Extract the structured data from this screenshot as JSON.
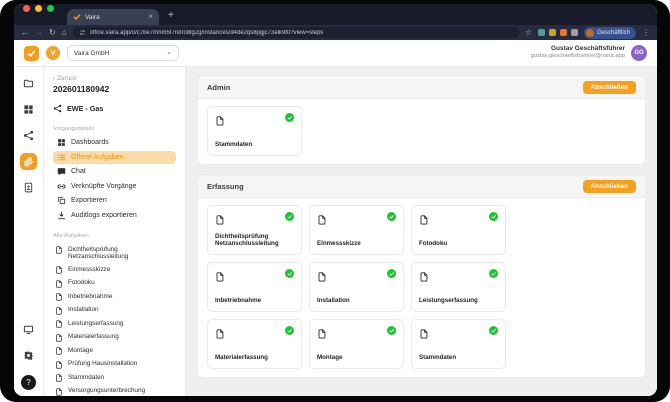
{
  "browser": {
    "tab_title": "Vaira",
    "url": "office.vaira.app/o/c7be7mnm5f7ndro8lg2g/instances/d4de2qs8pgjc73alk9t0?view=steps",
    "profile_label": "Geschäftlich"
  },
  "icons": {
    "back": "←",
    "forward": "→",
    "reload": "↻",
    "home": "⌂",
    "star": "☆",
    "menu_dots": "⋮",
    "tab_close": "×",
    "new_tab": "+",
    "chevron_down": "⌄",
    "chevron_left": "‹",
    "help": "?"
  },
  "topbar": {
    "org_name": "Vaira GmbH",
    "org_initial": "V",
    "user_name": "Gustav Geschäftsführer",
    "user_email": "gustav.geschaeftsfuehrer@vaira.app",
    "user_initials": "GG"
  },
  "rail": {
    "top_items": [
      {
        "icon": "folder"
      },
      {
        "icon": "table"
      },
      {
        "icon": "workflow"
      },
      {
        "icon": "paperclip",
        "active": true
      },
      {
        "icon": "idbadge"
      }
    ],
    "bottom_items": [
      {
        "icon": "devices",
        "badge": true
      },
      {
        "icon": "gear"
      }
    ]
  },
  "sidebar": {
    "back_label": "Zurück",
    "process_number": "202601180942",
    "process_type": "EWE - Gas",
    "details_section_label": "Vorgangsdetails",
    "detail_items": [
      {
        "label": "Dashboards",
        "icon": "grid",
        "active": false
      },
      {
        "label": "Offene Aufgaben",
        "icon": "tasks",
        "active": true
      },
      {
        "label": "Chat",
        "icon": "chat",
        "active": false
      },
      {
        "label": "Verknüpfte Vorgänge",
        "icon": "link",
        "active": false
      },
      {
        "label": "Exportieren",
        "icon": "export",
        "active": false
      },
      {
        "label": "Auditlogs exportieren",
        "icon": "download",
        "active": false
      }
    ],
    "tasks_section_label": "Alle Aufgaben",
    "task_items": [
      "Dichtheitsprüfung Netzanschlussleitung",
      "Einmessskizze",
      "Fotodoku",
      "Inbetriebnahme",
      "Installation",
      "Leistungserfassung",
      "Materialerfassung",
      "Montage",
      "Prüfung Hausinstallation",
      "Stammdaten",
      "Versorgungsunterbrechung"
    ]
  },
  "main": {
    "sections": [
      {
        "title": "Admin",
        "action_label": "Abschließen",
        "cards": [
          {
            "label": "Stammdaten",
            "status": "done"
          }
        ]
      },
      {
        "title": "Erfassung",
        "action_label": "Abschließen",
        "cards": [
          {
            "label": "Dichtheitsprüfung Netzanschlussleitung",
            "status": "done"
          },
          {
            "label": "Einmessskizze",
            "status": "done"
          },
          {
            "label": "Fotodoku",
            "status": "done"
          },
          {
            "label": "Inbetriebnahme",
            "status": "done"
          },
          {
            "label": "Installation",
            "status": "done"
          },
          {
            "label": "Leistungserfassung",
            "status": "done"
          },
          {
            "label": "Materialerfassung",
            "status": "done"
          },
          {
            "label": "Montage",
            "status": "done"
          },
          {
            "label": "Stammdaten",
            "status": "done"
          }
        ]
      }
    ]
  },
  "colors": {
    "accent": "#F59B1E",
    "accent_light": "#FBDCA9",
    "success": "#1CC52E",
    "avatar_purple": "#8A64C9"
  }
}
